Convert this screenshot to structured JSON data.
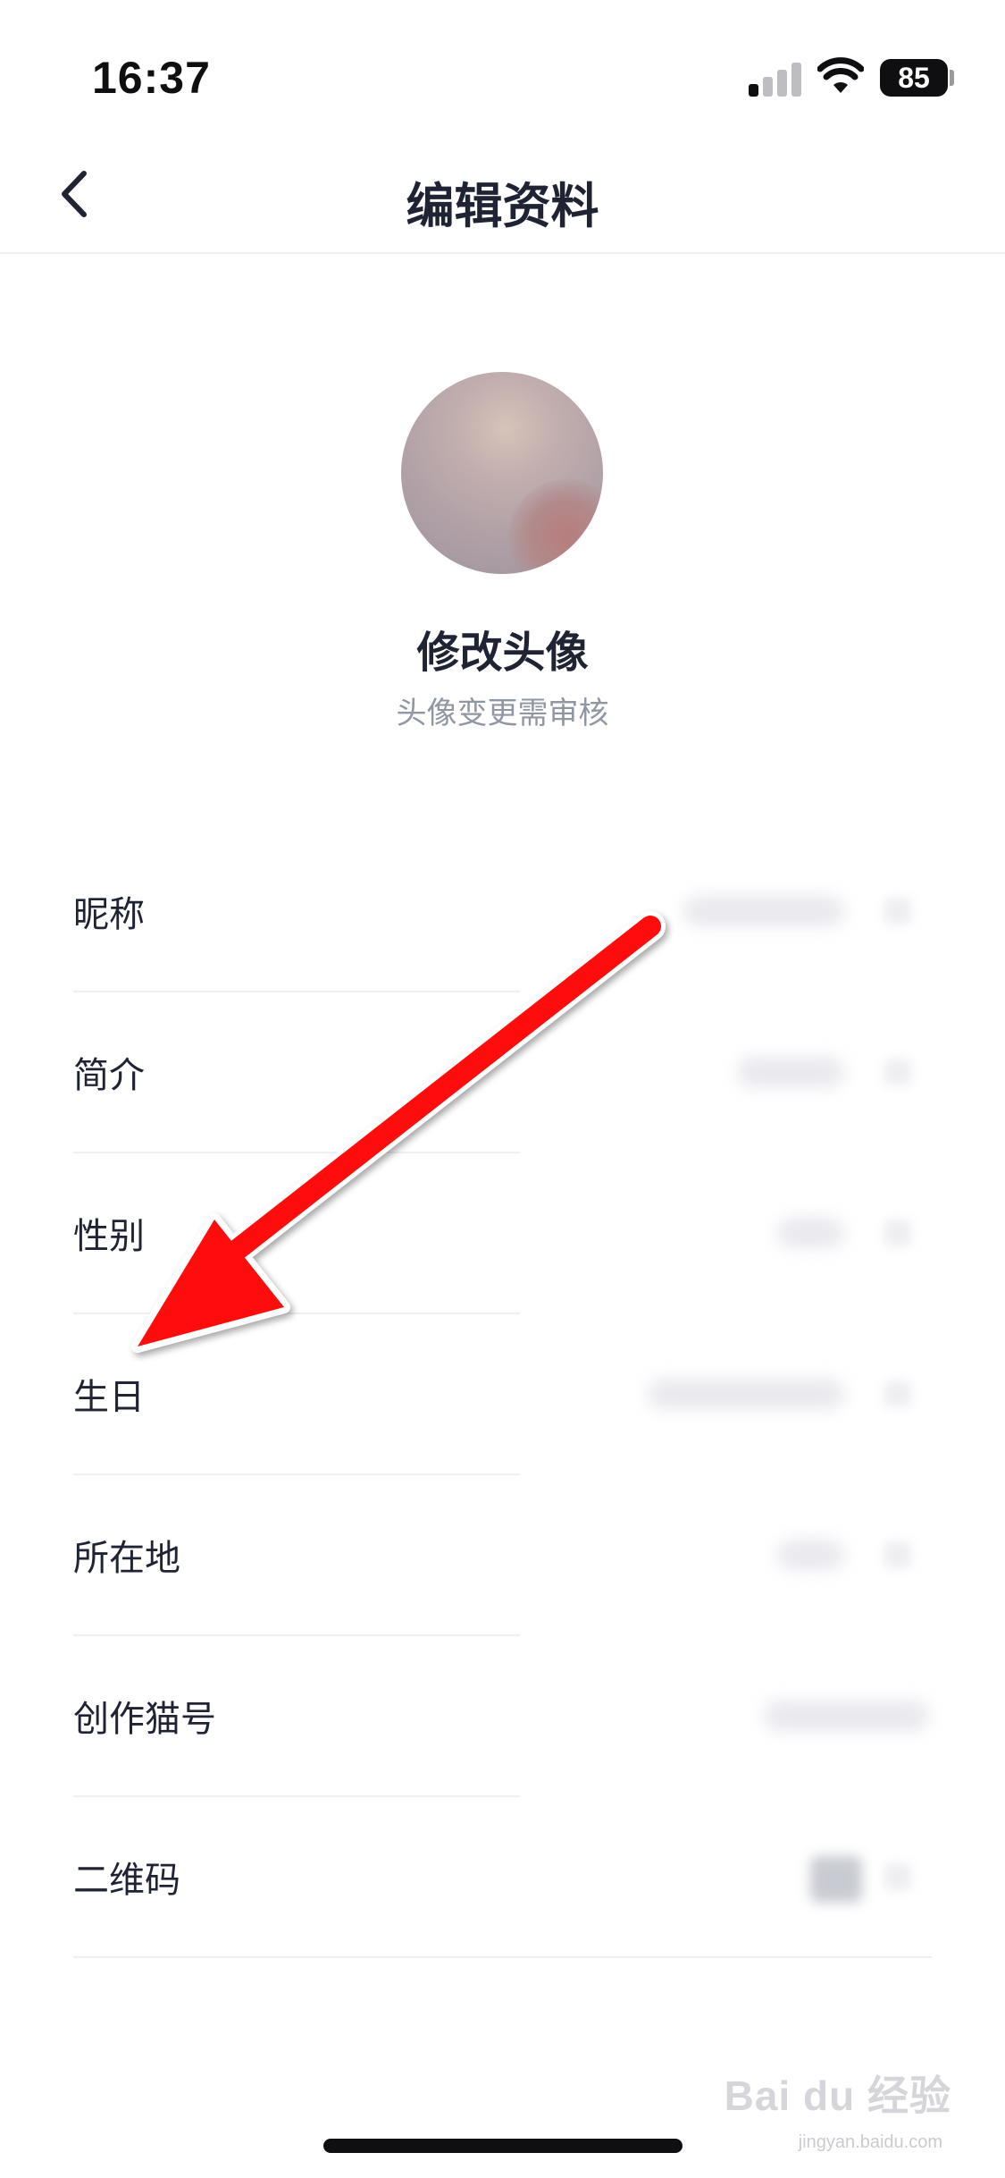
{
  "status_bar": {
    "time": "16:37",
    "battery": "85",
    "signal_icon": "cellular-signal-icon",
    "wifi_icon": "wifi-icon"
  },
  "nav": {
    "title": "编辑资料",
    "back_icon": "chevron-left-icon"
  },
  "avatar": {
    "title": "修改头像",
    "subtitle": "头像变更需审核"
  },
  "rows": [
    {
      "label": "昵称"
    },
    {
      "label": "简介"
    },
    {
      "label": "性别"
    },
    {
      "label": "生日"
    },
    {
      "label": "所在地"
    },
    {
      "label": "创作猫号"
    },
    {
      "label": "二维码"
    }
  ],
  "annotation": {
    "color": "#ff1010"
  },
  "watermark": {
    "text": "Bai du 经验",
    "url": "jingyan.baidu.com"
  }
}
